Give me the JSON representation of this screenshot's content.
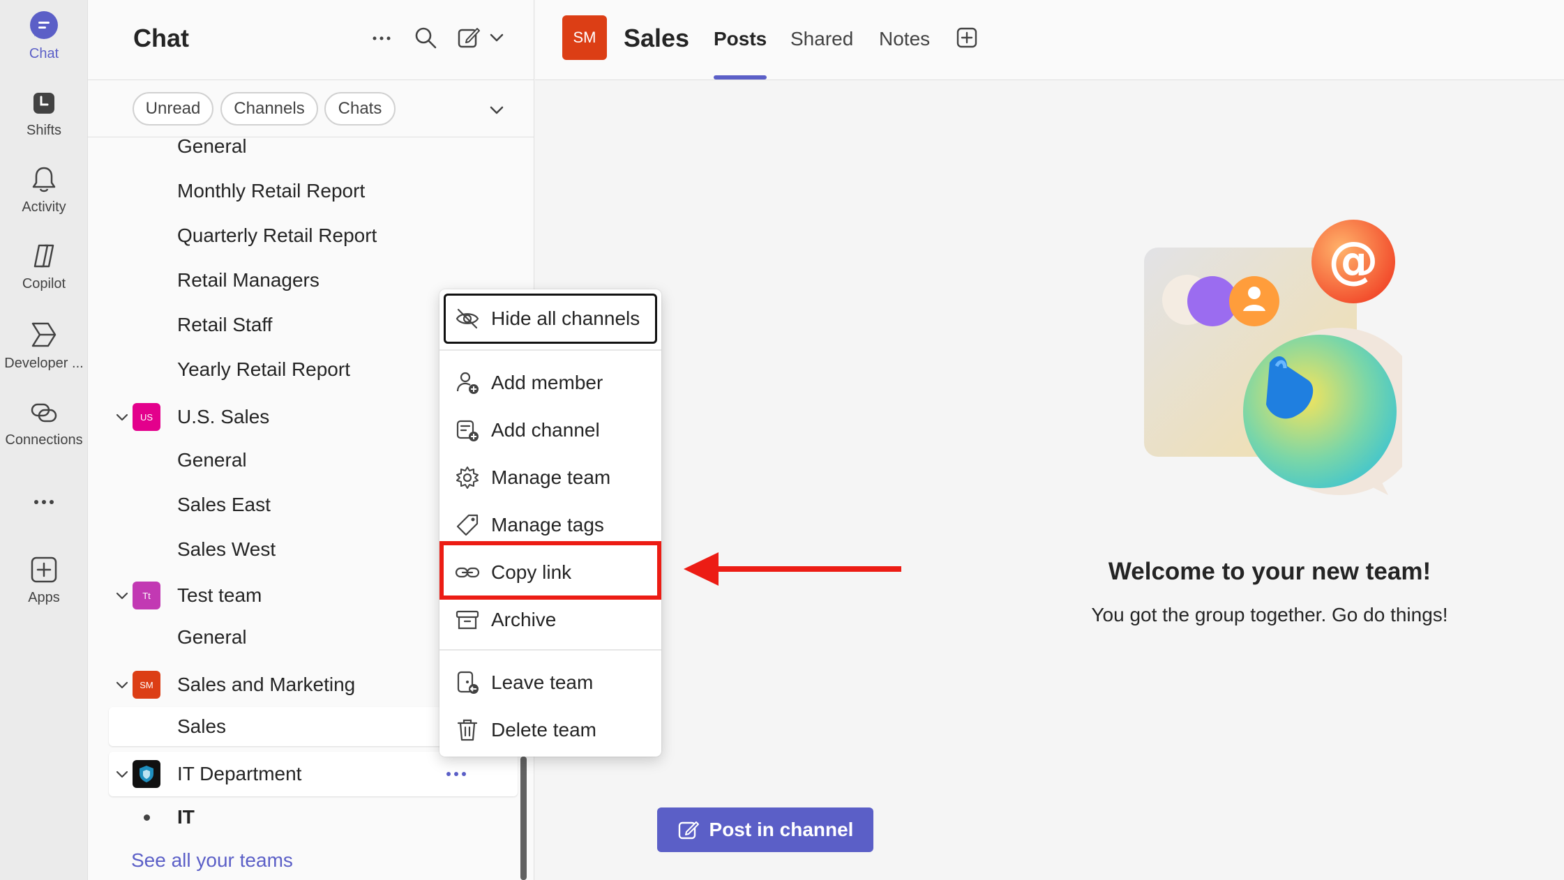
{
  "rail": {
    "items": [
      {
        "label": "Chat",
        "icon": "chat-icon",
        "active": true
      },
      {
        "label": "Shifts",
        "icon": "shifts-icon"
      },
      {
        "label": "Activity",
        "icon": "bell-icon"
      },
      {
        "label": "Copilot",
        "icon": "copilot-icon"
      },
      {
        "label": "Developer ...",
        "icon": "developer-icon"
      },
      {
        "label": "Connections",
        "icon": "connections-icon"
      },
      {
        "label": "",
        "icon": "more-icon"
      },
      {
        "label": "Apps",
        "icon": "apps-icon"
      }
    ]
  },
  "pane": {
    "title": "Chat",
    "filters": [
      "Unread",
      "Channels",
      "Chats"
    ],
    "rows": {
      "general_1": "General",
      "monthly": "Monthly Retail Report",
      "quarterly": "Quarterly Retail Report",
      "managers": "Retail Managers",
      "staff": "Retail Staff",
      "yearly": "Yearly Retail Report",
      "us_sales": "U.S. Sales",
      "us_sales_av": "US",
      "general_2": "General",
      "sales_east": "Sales East",
      "sales_west": "Sales West",
      "test_team": "Test team",
      "test_team_av": "Tt",
      "general_3": "General",
      "sales_marketing": "Sales and Marketing",
      "sales_marketing_av": "SM",
      "sales": "Sales",
      "it_dept": "IT Department",
      "it": "IT",
      "see_all": "See all your teams"
    }
  },
  "header": {
    "avatar": "SM",
    "channel": "Sales",
    "tabs": [
      "Posts",
      "Shared",
      "Notes"
    ]
  },
  "menu": {
    "hide_all": "Hide all channels",
    "add_member": "Add member",
    "add_channel": "Add channel",
    "manage_team": "Manage team",
    "manage_tags": "Manage tags",
    "copy_link": "Copy link",
    "archive": "Archive",
    "leave_team": "Leave team",
    "delete_team": "Delete team"
  },
  "welcome": {
    "title": "Welcome to your new team!",
    "subtitle": "You got the group together. Go do things!"
  },
  "post_button": "Post in channel",
  "colors": {
    "brand": "#5b5fc7",
    "annotation_red": "#ec1c14",
    "team_sm": "#dc3e15",
    "team_us": "#e3008c",
    "team_tt": "#c239b3"
  }
}
